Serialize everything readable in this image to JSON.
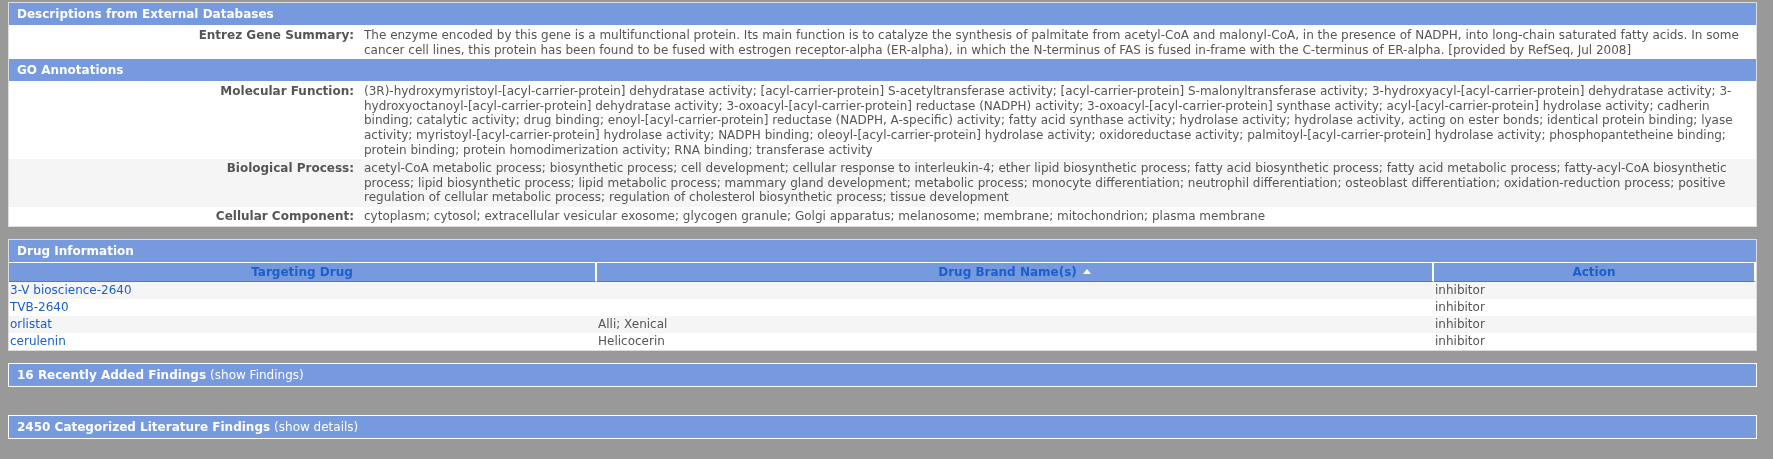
{
  "descriptions": {
    "title": "Descriptions from External Databases",
    "rows": [
      {
        "label": "Entrez Gene Summary:",
        "value": "The enzyme encoded by this gene is a multifunctional protein. Its main function is to catalyze the synthesis of palmitate from acetyl-CoA and malonyl-CoA, in the presence of NADPH, into long-chain saturated fatty acids. In some cancer cell lines, this protein has been found to be fused with estrogen receptor-alpha (ER-alpha), in which the N-terminus of FAS is fused in-frame with the C-terminus of ER-alpha. [provided by RefSeq, Jul 2008]"
      }
    ]
  },
  "go_annotations": {
    "title": "GO Annotations",
    "rows": [
      {
        "label": "Molecular Function:",
        "value": "(3R)-hydroxymyristoyl-[acyl-carrier-protein] dehydratase activity; [acyl-carrier-protein] S-acetyltransferase activity; [acyl-carrier-protein] S-malonyltransferase activity; 3-hydroxyacyl-[acyl-carrier-protein] dehydratase activity; 3-hydroxyoctanoyl-[acyl-carrier-protein] dehydratase activity; 3-oxoacyl-[acyl-carrier-protein] reductase (NADPH) activity; 3-oxoacyl-[acyl-carrier-protein] synthase activity; acyl-[acyl-carrier-protein] hydrolase activity; cadherin binding; catalytic activity; drug binding; enoyl-[acyl-carrier-protein] reductase (NADPH, A-specific) activity; fatty acid synthase activity; hydrolase activity; hydrolase activity, acting on ester bonds; identical protein binding; lyase activity; myristoyl-[acyl-carrier-protein] hydrolase activity; NADPH binding; oleoyl-[acyl-carrier-protein] hydrolase activity; oxidoreductase activity; palmitoyl-[acyl-carrier-protein] hydrolase activity; phosphopantetheine binding; protein binding; protein homodimerization activity; RNA binding; transferase activity"
      },
      {
        "label": "Biological Process:",
        "value": "acetyl-CoA metabolic process; biosynthetic process; cell development; cellular response to interleukin-4; ether lipid biosynthetic process; fatty acid biosynthetic process; fatty acid metabolic process; fatty-acyl-CoA biosynthetic process; lipid biosynthetic process; lipid metabolic process; mammary gland development; metabolic process; monocyte differentiation; neutrophil differentiation; osteoblast differentiation; oxidation-reduction process; positive regulation of cellular metabolic process; regulation of cholesterol biosynthetic process; tissue development"
      },
      {
        "label": "Cellular Component:",
        "value": "cytoplasm; cytosol; extracellular vesicular exosome; glycogen granule; Golgi apparatus; melanosome; membrane; mitochondrion; plasma membrane"
      }
    ]
  },
  "drug_information": {
    "title": "Drug Information",
    "columns": [
      {
        "label": "Targeting Drug",
        "sorted": false
      },
      {
        "label": "Drug Brand Name(s)",
        "sorted": true
      },
      {
        "label": "Action",
        "sorted": false
      }
    ],
    "rows": [
      {
        "drug": "3-V bioscience-2640",
        "action": "inhibitor"
      },
      {
        "drug": "TVB-2640",
        "action": "inhibitor"
      },
      {
        "drug": "orlistat",
        "brand_names": "Alli; Xenical",
        "action": "inhibitor"
      },
      {
        "drug": "cerulenin",
        "brand_names": "Helicocerin",
        "action": "inhibitor"
      }
    ]
  },
  "findings_bars": [
    {
      "title": "16 Recently Added Findings",
      "link": "(show Findings)"
    },
    {
      "title": "2450 Categorized Literature Findings",
      "link": "(show details)"
    }
  ]
}
